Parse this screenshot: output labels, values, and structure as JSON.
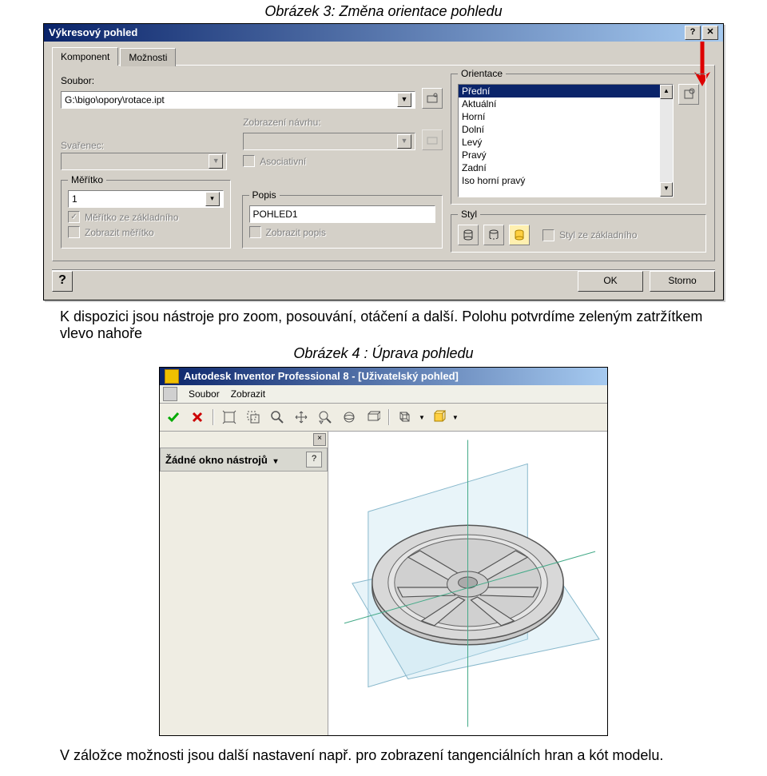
{
  "caption3": "Obrázek 3: Změna orientace pohledu",
  "dialog1": {
    "title": "Výkresový pohled",
    "tabs": {
      "komponent": "Komponent",
      "moznosti": "Možnosti"
    },
    "soubor_label": "Soubor:",
    "soubor_value": "G:\\bigo\\opory\\rotace.ipt",
    "svarenec_label": "Svařenec:",
    "zobrazeni_label": "Zobrazení návrhu:",
    "asociativni": "Asociativní",
    "meritko": {
      "legend": "Měřítko",
      "value": "1",
      "chk_zakladni": "Měřítko ze základního",
      "chk_zobrazit": "Zobrazit měřítko"
    },
    "popis": {
      "legend": "Popis",
      "value": "POHLED1",
      "chk_zobrazit": "Zobrazit popis"
    },
    "orientace": {
      "legend": "Orientace",
      "items": [
        "Přední",
        "Aktuální",
        "Horní",
        "Dolní",
        "Levý",
        "Pravý",
        "Zadní",
        "Iso horní pravý"
      ],
      "selected": 0
    },
    "styl": {
      "legend": "Styl",
      "chk": "Styl ze základního"
    },
    "buttons": {
      "help": "?",
      "ok": "OK",
      "cancel": "Storno"
    }
  },
  "midtext": "K dispozici jsou nástroje pro zoom, posouvání, otáčení a další. Polohu potvrdíme zeleným zatržítkem vlevo nahoře",
  "caption4": "Obrázek 4 : Úprava pohledu",
  "inventor": {
    "title": "Autodesk Inventor Professional 8 - [Uživatelský pohled]",
    "menu": {
      "soubor": "Soubor",
      "zobrazit": "Zobrazit"
    },
    "panel": {
      "title": "Žádné okno nástrojů",
      "caret": "▾",
      "help": "?"
    }
  },
  "footer": "V záložce možnosti jsou další nastavení např. pro zobrazení tangenciálních hran a kót modelu."
}
